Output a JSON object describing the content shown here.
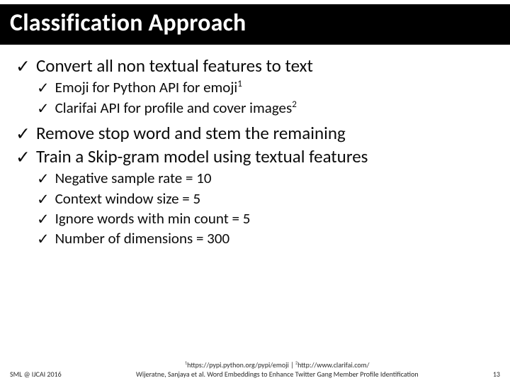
{
  "title": "Classification Approach",
  "bullets": {
    "b1": "Convert all non textual features to text",
    "b1a": "Emoji for Python API for emoji",
    "b1a_sup": "1",
    "b1b": "Clarifai API for profile and cover images",
    "b1b_sup": "2",
    "b2": "Remove stop word and stem the remaining",
    "b3": "Train a Skip-gram model using textual features",
    "b3a": "Negative sample rate = 10",
    "b3b": "Context window size = 5",
    "b3c": "Ignore words with min count = 5",
    "b3d": "Number of dimensions = 300"
  },
  "footer": {
    "left": "SML @ IJCAI 2016",
    "refs_sup1": "1",
    "refs_url1": "https://pypi.python.org/pypi/emoji",
    "refs_sep": " | ",
    "refs_sup2": "2",
    "refs_url2": "http://www.clarifai.com/",
    "citation": "Wijeratne, Sanjaya et al. Word Embeddings to Enhance Twitter Gang Member Profile Identification",
    "page": "13"
  }
}
